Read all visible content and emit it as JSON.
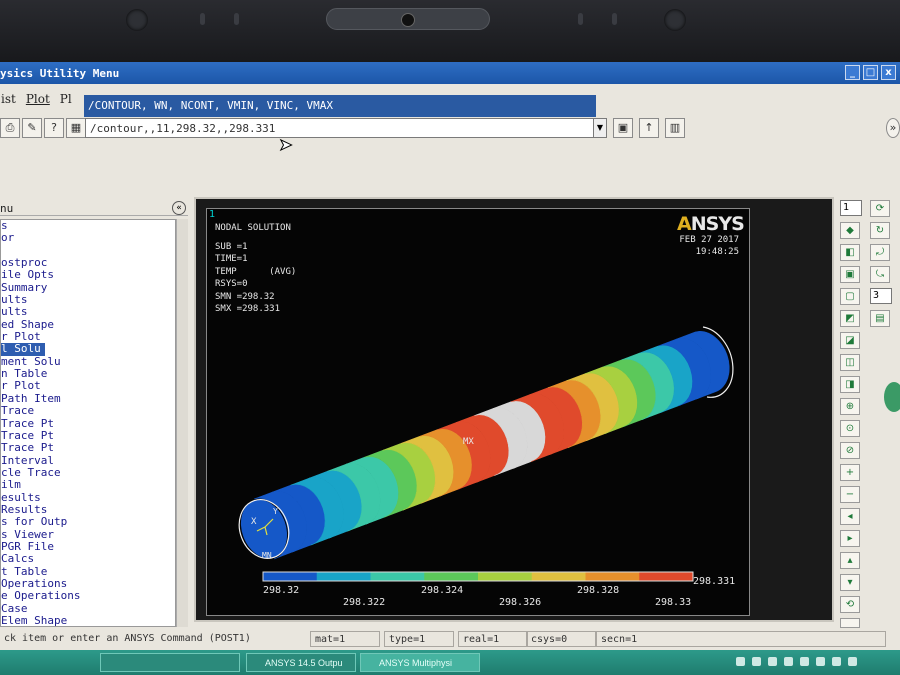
{
  "window": {
    "title": "ysics Utility Menu",
    "controls": [
      "_",
      "□",
      "x"
    ]
  },
  "menubar": {
    "items": [
      "ist",
      "Plot",
      "Pl"
    ]
  },
  "command_tooltip": "/CONTOUR, WN, NCONT, VMIN, VINC, VMAX",
  "toolbar": {
    "command_input": "/contour,,11,298.32,,298.331"
  },
  "main_menu": {
    "header": "nu",
    "items": [
      "s",
      "or",
      "",
      "ostproc",
      "ile Opts",
      "Summary",
      "ults",
      "ults",
      "ed Shape",
      "r Plot",
      "l Solu",
      "ment Solu",
      "n Table",
      "r Plot",
      "Path Item",
      "Trace",
      "Trace Pt",
      "Trace Pt",
      "Trace Pt",
      "Interval",
      "cle Trace",
      "ilm",
      "esults",
      "Results",
      "s for Outp",
      "s Viewer",
      "PGR File",
      "Calcs",
      "t Table",
      "Operations",
      "e Operations",
      "Case",
      "Elem Shape"
    ],
    "selected_index": 10
  },
  "graphics": {
    "window_number": "1",
    "logo": "ANSYS",
    "info_lines": [
      "NODAL SOLUTION",
      "SUB =1",
      "TIME=1",
      "TEMP      (AVG)",
      "RSYS=0",
      "SMN =298.32",
      "SMX =298.331"
    ],
    "date": "FEB 27 2017",
    "time": "19:48:25",
    "max_marker": "MX",
    "min_marker": "MN",
    "triad": {
      "x": "X",
      "y": "Y"
    },
    "legend": {
      "labels": [
        "298.32",
        "298.322",
        "298.324",
        "298.326",
        "298.328",
        "298.33",
        "298.331"
      ],
      "colors": [
        "#1558c8",
        "#19a4c8",
        "#3cc8a8",
        "#5cc85a",
        "#a8d040",
        "#e0c040",
        "#e6902c",
        "#e04a2c",
        "#d8d8d8"
      ]
    }
  },
  "right_toolbar": {
    "select_1": "1",
    "select_2": "3"
  },
  "status_bar": {
    "prompt": "ck item or enter an ANSYS Command (POST1)",
    "mat": "mat=1",
    "type": "type=1",
    "real": "real=1",
    "csys": "csys=0",
    "secn": "secn=1"
  },
  "taskbar": {
    "tasks": [
      "",
      "ANSYS 14.5 Outpu",
      "ANSYS Multiphysi"
    ]
  }
}
